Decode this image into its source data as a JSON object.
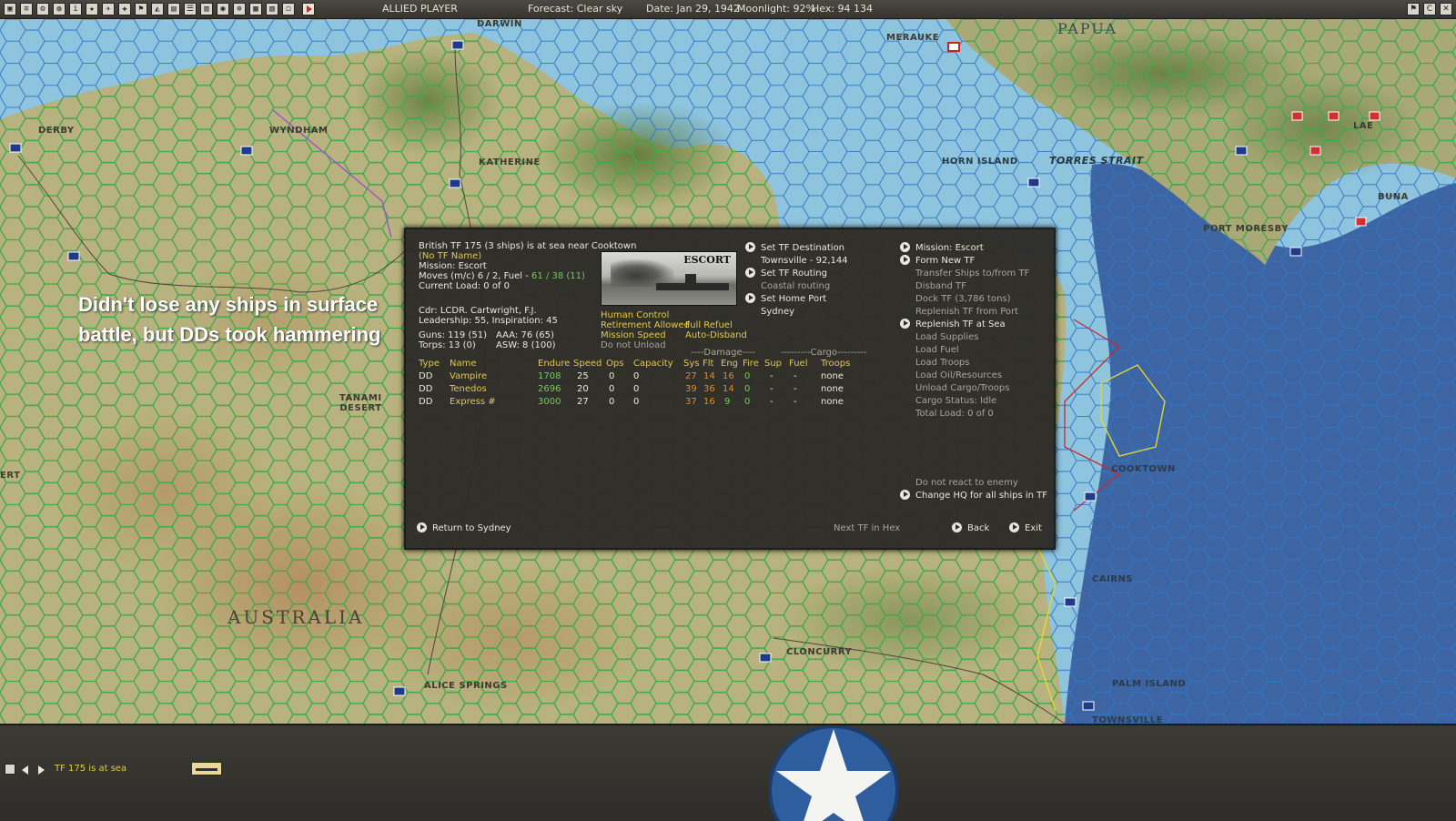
{
  "topbar": {
    "player": "ALLIED PLAYER",
    "forecast": "Forecast: Clear sky",
    "date": "Date: Jan 29, 1942",
    "moonlight": "Moonlight: 92%",
    "hex": "Hex: 94 134",
    "icons": [
      "save-icon",
      "report-icon",
      "settings-icon",
      "info-icon",
      "intel-icon",
      "ships-icon",
      "air-icon",
      "ground-icon",
      "flag-icon",
      "map-icon",
      "chart-icon",
      "list-icon",
      "filter-icon",
      "globe-icon",
      "target-icon",
      "overlay-icon",
      "table-icon",
      "window-icon",
      "end-turn-icon"
    ],
    "window_controls": [
      "flag-icon",
      "restore-icon",
      "close-icon"
    ]
  },
  "map": {
    "places": {
      "darwin": "DARWIN",
      "merauke": "MERAUKE",
      "papua": "PAPUA",
      "derby": "DERBY",
      "wyndham": "WYNDHAM",
      "katherine": "KATHERINE",
      "horn_island": "HORN ISLAND",
      "torres_strait": "TORRES STRAIT",
      "lae": "LAE",
      "buna": "BUNA",
      "port_moresby": "PORT MORESBY",
      "tanami_desert": "TANAMI\nDESERT",
      "cooktown": "COOKTOWN",
      "cairns": "CAIRNS",
      "australia": "AUSTRALIA",
      "cloncurry": "CLONCURRY",
      "alice_springs": "ALICE SPRINGS",
      "palm_island": "PALM ISLAND",
      "townsville": "TOWNSVILLE",
      "ert": "ERT"
    }
  },
  "annotation": "Didn't lose any ships in surface battle, but DDs took hammering",
  "tf": {
    "header": "British TF 175 (3 ships) is at sea near Cooktown",
    "tf_name": "(No TF Name)",
    "mission": "Mission: Escort",
    "moves_label": "Moves (m/c) 6 / 2, Fuel - ",
    "fuel_value": "61 / 38 (11)",
    "current_load": "Current Load: 0 of 0",
    "commander": "Cdr: LCDR. Cartwright, F.J.",
    "leadership": "Leadership: 55, Inspiration: 45",
    "guns": "Guns: 119 (51)",
    "aaa": "AAA: 76 (65)",
    "torps": "Torps: 13 (0)",
    "asw": "ASW: 8 (100)",
    "photo_label": "ESCORT",
    "opt_human_control": "Human Control",
    "opt_retirement": "Retirement Allowed",
    "opt_full_refuel": "Full Refuel",
    "opt_mission_speed": "Mission Speed",
    "opt_auto_disband": "Auto-Disband",
    "opt_do_not_unload": "Do not Unload",
    "damage_group": "----Damage----",
    "cargo_group": "---------Cargo---------",
    "columns": [
      "Type",
      "Name",
      "Endure",
      "Speed",
      "Ops",
      "Capacity",
      "Sys",
      "Flt",
      "Eng",
      "Fire",
      "Sup",
      "Fuel",
      "Troops"
    ],
    "ships": [
      {
        "type": "DD",
        "name": "Vampire",
        "endure": "1708",
        "speed": "25",
        "ops": "0",
        "capacity": "0",
        "sys": "27",
        "flt": "14",
        "eng": "16",
        "fire": "0",
        "sup": "-",
        "fuel": "-",
        "troops": "none"
      },
      {
        "type": "DD",
        "name": "Tenedos",
        "endure": "2696",
        "speed": "20",
        "ops": "0",
        "capacity": "0",
        "sys": "39",
        "flt": "36",
        "eng": "14",
        "fire": "0",
        "sup": "-",
        "fuel": "-",
        "troops": "none"
      },
      {
        "type": "DD",
        "name": "Express #",
        "endure": "3000",
        "speed": "27",
        "ops": "0",
        "capacity": "0",
        "sys": "37",
        "flt": "16",
        "eng": "9",
        "fire": "0",
        "sup": "-",
        "fuel": "-",
        "troops": "none"
      }
    ],
    "mid_commands": {
      "set_destination": "Set TF Destination",
      "destination_value": "Townsville - 92,144",
      "set_routing": "Set TF Routing",
      "routing_value": "Coastal routing",
      "set_home_port": "Set Home Port",
      "home_port_value": "Sydney"
    },
    "right_commands": {
      "mission_escort": "Mission: Escort",
      "form_new_tf": "Form New TF",
      "transfer_ships": "Transfer Ships to/from TF",
      "disband_tf": "Disband TF",
      "dock_tf": "Dock TF (3,786 tons)",
      "replenish_port": "Replenish TF from Port",
      "replenish_sea": "Replenish TF at Sea",
      "load_supplies": "Load Supplies",
      "load_fuel": "Load Fuel",
      "load_troops": "Load Troops",
      "load_oil": "Load Oil/Resources",
      "unload_cargo": "Unload Cargo/Troops",
      "cargo_status": "Cargo Status: Idle",
      "total_load": "Total Load: 0 of 0",
      "do_not_react": "Do not react to enemy",
      "change_hq": "Change HQ for all ships in TF"
    },
    "footer": {
      "return_to": "Return to Sydney",
      "next_tf": "Next TF in Hex",
      "back": "Back",
      "exit": "Exit"
    }
  },
  "bottombar": {
    "status": "TF 175 is at sea"
  },
  "colors": {
    "panel_bg": "#2c2b27",
    "yellow_text": "#e3c84a",
    "green_text": "#6fd14a",
    "orange_text": "#e08a2a",
    "grey_text": "#a9a59a",
    "hex_green": "#3fae3a",
    "sea_light": "#8fc4de",
    "sea_deep": "#3d64a3",
    "land": "#b4b07e"
  }
}
